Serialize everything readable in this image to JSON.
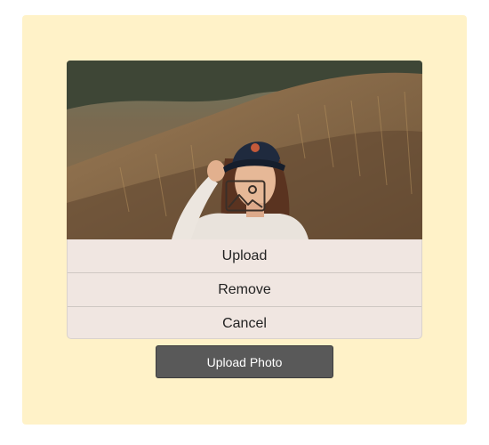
{
  "photo": {
    "alt": "Profile photo preview",
    "overlay_icon": "image-placeholder-icon"
  },
  "menu": {
    "items": [
      {
        "label": "Upload"
      },
      {
        "label": "Remove"
      },
      {
        "label": "Cancel"
      }
    ]
  },
  "upload_button": {
    "label": "Upload Photo"
  },
  "colors": {
    "card_background": "#fff2c8",
    "menu_background": "#f0e6e1",
    "button_background": "#595959",
    "button_text": "#ffffff"
  }
}
